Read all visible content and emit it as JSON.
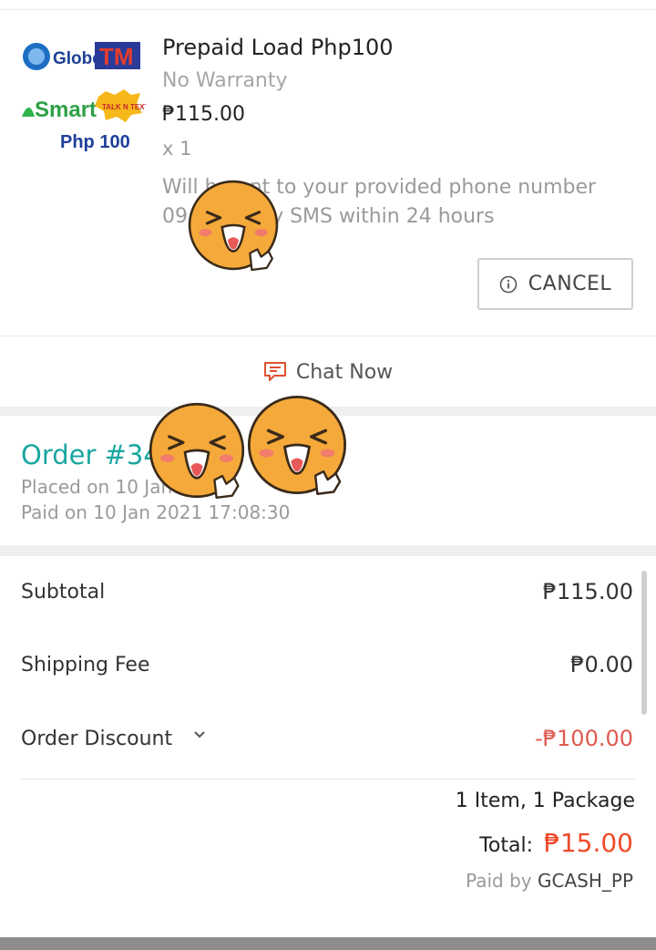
{
  "product": {
    "thumbnail": {
      "brand_globe": "Globe",
      "brand_tm": "TM",
      "brand_smart": "Smart",
      "brand_tnt": "TALK N TEXT",
      "amount": "Php 100"
    },
    "name": "Prepaid Load Php100",
    "warranty": "No Warranty",
    "price": "₱115.00",
    "quantity": "x 1",
    "note_line1": "Will b        nt to your provided phone number",
    "note_line2": "09             5 by SMS within 24 hours",
    "cancel_label": "CANCEL"
  },
  "chat": {
    "label": "Chat Now"
  },
  "order": {
    "number": "Order #34                          37",
    "placed": "Placed on 10 Jan                   7:07",
    "paid": "Paid on 10 Jan 2021  17:08:30"
  },
  "summary": {
    "subtotal_label": "Subtotal",
    "subtotal_value": "₱115.00",
    "shipping_label": "Shipping Fee",
    "shipping_value": "₱0.00",
    "discount_label": "Order Discount",
    "discount_value": "-₱100.00",
    "items_count": "1 Item, 1 Package",
    "total_label": "Total:",
    "total_value": "₱15.00",
    "paid_by_prefix": "Paid by ",
    "paid_by_method": "GCASH_PP"
  },
  "colors": {
    "order_teal": "#1aa6a0",
    "total_red": "#f04a2a",
    "discount_red": "#e05a50",
    "chat_icon": "#e0502e",
    "sticker_face": "#f5a93a"
  },
  "icons": {
    "cancel": "info-circle-icon",
    "chat": "chat-bubble-icon",
    "discount_toggle": "chevron-down-icon",
    "sticker": "laughing-face-sticker"
  }
}
